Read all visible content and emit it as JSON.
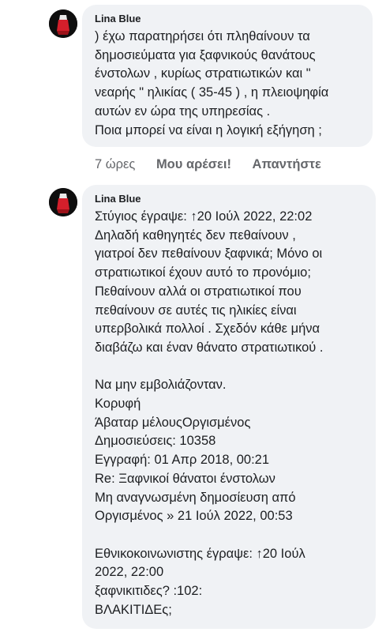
{
  "comments": [
    {
      "author": "Lina Blue",
      "lines": [
        ") έχω παρατηρήσει ότι πληθαίνουν τα",
        "δημοσιεύματα για ξαφνικούς θανάτους",
        "ένστολων , κυρίως στρατιωτικών και \"",
        "νεαρής \" ηλικίας ( 35-45 ) , η πλειοψηφία",
        "αυτών εν ώρα της υπηρεσίας .",
        "Ποια μπορεί να είναι η λογική εξήγηση ;"
      ],
      "time": "7 ώρες",
      "like_label": "Μου αρέσει!",
      "reply_label": "Απαντήστε"
    },
    {
      "author": "Lina Blue",
      "lines": [
        "Στύγιος έγραψε: ↑20 Ιούλ 2022, 22:02",
        "Δηλαδή καθηγητές δεν πεθαίνουν ,",
        "γιατροί δεν πεθαίνουν ξαφνικά; Μόνο οι",
        "στρατιωτικοί έχουν αυτό το προνόμιο;",
        "Πεθαίνουν αλλά οι στρατιωτικοί που",
        "πεθαίνουν σε αυτές τις ηλικίες είναι",
        "υπερβολικά πολλοί . Σχεδόν κάθε μήνα",
        "διαβάζω και έναν θάνατο στρατιωτικού .",
        "",
        "Να μην εμβολιάζονταν.",
        "Κορυφή",
        "Άβαταρ μέλουςΟργισμένος",
        "Δημοσιεύσεις: 10358",
        "Εγγραφή: 01 Απρ 2018, 00:21",
        "Re: Ξαφνικοί θάνατοι ένστολων",
        "Μη αναγνωσμένη δημοσίευση από",
        "Οργισμένος » 21 Ιούλ 2022, 00:53",
        "",
        "Εθνικοκοινωνιστης έγραψε: ↑20 Ιούλ",
        "2022, 22:00",
        "ξαφνικιτιδες? :102:",
        "ΒΛΑΚΙΤΙΔΕς;"
      ]
    }
  ]
}
